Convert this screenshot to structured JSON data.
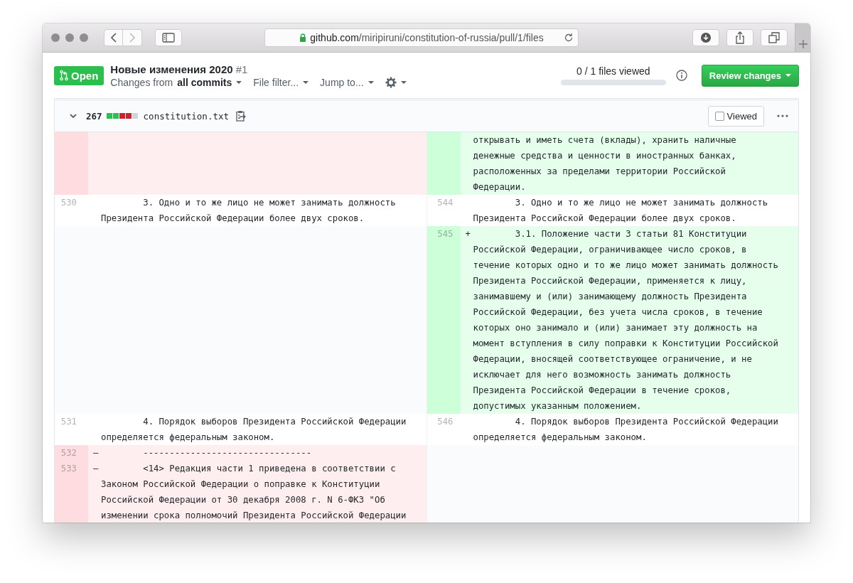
{
  "browser": {
    "url_host": "github.com",
    "url_path": "/miripiruni/constitution-of-russia/pull/1/files"
  },
  "pull_request": {
    "state": "Open",
    "title": "Новые изменения 2020",
    "number": "#1",
    "changes_from_label": "Changes from",
    "changes_from_value": "all commits",
    "menus": [
      "File filter...",
      "Jump to..."
    ],
    "files_viewed": "0 / 1 files viewed",
    "progress": {
      "level": 0
    },
    "review_button": "Review changes"
  },
  "file": {
    "expanded": true,
    "changes": "267",
    "diffstat": [
      {
        "color": "#2cbe4e"
      },
      {
        "color": "#2cbe4e"
      },
      {
        "color": "#cb2431"
      },
      {
        "color": "#cb2431"
      },
      {
        "color": "#d1d5da"
      }
    ],
    "name": "constitution.txt",
    "viewed_label": "Viewed",
    "viewed": false
  },
  "rows": [
    {
      "left": {
        "kind": "del"
      },
      "right": {
        "kind": "add",
        "lines": [
          "открывать и иметь счета (вклады), хранить наличные",
          "денежные средства и ценности в иностранных банках,",
          "расположенных за пределами территории Российской",
          "Федерации."
        ]
      }
    },
    {
      "left": {
        "kind": "ctx",
        "number": "530",
        "lines": [
          "        3. Одно и то же лицо не может занимать должность",
          "Президента Российской Федерации более двух сроков."
        ]
      },
      "right": {
        "kind": "ctx",
        "number": "544",
        "lines": [
          "        3. Одно и то же лицо не может занимать должность",
          "Президента Российской Федерации более двух сроков."
        ]
      }
    },
    {
      "left": {
        "kind": "blank"
      },
      "right": {
        "kind": "add",
        "number": "545",
        "sign": "+",
        "lines": [
          "        3.1. Положение части 3 статьи 81 Конституции",
          "Российской Федерации, ограничивающее число сроков, в",
          "течение которых одно и то же лицо может занимать должность",
          "Президента Российской Федерации, применяется к лицу,",
          "занимавшему и (или) занимающему должность Президента",
          "Российской Федерации, без учета числа сроков, в течение",
          "которых оно занимало и (или) занимает эту должность на",
          "момент вступления в силу поправки к Конституции Российской",
          "Федерации, вносящей соответствующее ограничение, и не",
          "исключает для него возможность занимать должность",
          "Президента Российской Федерации в течение сроков,",
          "допустимых указанным положением."
        ]
      }
    },
    {
      "left": {
        "kind": "ctx",
        "number": "531",
        "lines": [
          "        4. Порядок выборов Президента Российской Федерации",
          "определяется федеральным законом."
        ]
      },
      "right": {
        "kind": "ctx",
        "number": "546",
        "lines": [
          "        4. Порядок выборов Президента Российской Федерации",
          "определяется федеральным законом."
        ]
      }
    },
    {
      "left": {
        "kind": "del",
        "number": "532",
        "sign": "–",
        "lines": [
          "        --------------------------------"
        ]
      },
      "right": {
        "kind": "blank"
      }
    },
    {
      "left": {
        "kind": "del",
        "number": "533",
        "sign": "–",
        "lines": [
          "        <14> Редакция части 1 приведена в соответствии с",
          "Законом Российской Федерации о поправке к Конституции",
          "Российской Федерации от 30 декабря 2008 г. N 6-ФКЗ \"Об",
          "изменении срока полномочий Президента Российской Федерации"
        ]
      },
      "right": {
        "kind": "blank"
      }
    }
  ]
}
